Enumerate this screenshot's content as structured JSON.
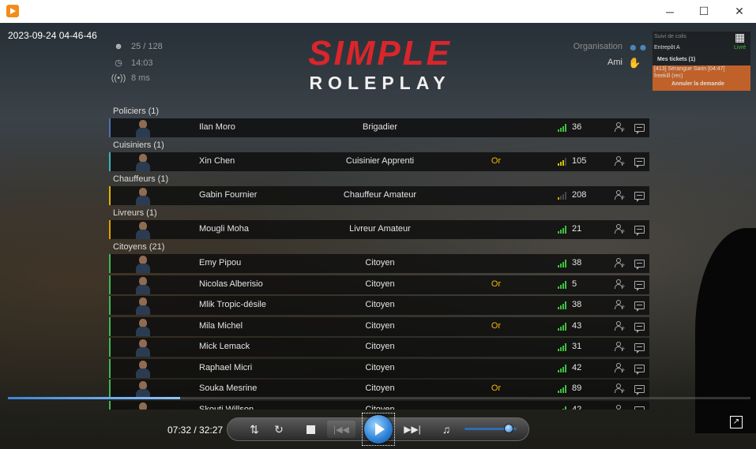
{
  "window": {
    "minimize_glyph": "─",
    "maximize_glyph": "☐",
    "close_glyph": "✕"
  },
  "timestamp": "2023-09-24 04-46-46",
  "stats": {
    "players": "25 / 128",
    "time": "14:03",
    "ping": "8 ms"
  },
  "logo": {
    "top": "SIMPLE",
    "bottom": "ROLEPLAY"
  },
  "relations": {
    "organisation": "Organisation",
    "ami": "Ami"
  },
  "notifications": {
    "suivi": "Suivi de colis",
    "entrepot": "Entrepôt A",
    "livre": "Livré",
    "tickets": "Mes tickets (1)",
    "ticket_line": "[413] Sérangue Sarin [04:47]",
    "ticket_sub": "freekill (rec)",
    "cancel": "Annuler la demande"
  },
  "colors": {
    "police": "#4f6fb5",
    "cook": "#37b7c0",
    "driver": "#e0b400",
    "delivery": "#e0a000",
    "citizen": "#3fb950",
    "signal_good": "#3fbf3f",
    "signal_mid": "#d6c200",
    "signal_low": "#e0a000",
    "vip": "#f5b800"
  },
  "categories": [
    {
      "label": "Policiers (1)",
      "color_key": "police",
      "players": [
        {
          "name": "Ilan Moro",
          "job": "Brigadier",
          "vip": "",
          "ping": "36",
          "signal": 4
        }
      ]
    },
    {
      "label": "Cuisiniers (1)",
      "color_key": "cook",
      "players": [
        {
          "name": "Xin Chen",
          "job": "Cuisinier Apprenti",
          "vip": "Or",
          "ping": "105",
          "signal": 3
        }
      ]
    },
    {
      "label": "Chauffeurs (1)",
      "color_key": "driver",
      "players": [
        {
          "name": "Gabin Fournier",
          "job": "Chauffeur Amateur",
          "vip": "",
          "ping": "208",
          "signal": 1
        }
      ]
    },
    {
      "label": "Livreurs (1)",
      "color_key": "delivery",
      "players": [
        {
          "name": "Mougli Moha",
          "job": "Livreur Amateur",
          "vip": "",
          "ping": "21",
          "signal": 4
        }
      ]
    },
    {
      "label": "Citoyens (21)",
      "color_key": "citizen",
      "players": [
        {
          "name": "Emy Pipou",
          "job": "Citoyen",
          "vip": "",
          "ping": "38",
          "signal": 4
        },
        {
          "name": "Nicolas Alberisio",
          "job": "Citoyen",
          "vip": "Or",
          "ping": "5",
          "signal": 4
        },
        {
          "name": "Mlik Tropic-désile",
          "job": "Citoyen",
          "vip": "",
          "ping": "38",
          "signal": 4
        },
        {
          "name": "Mila Michel",
          "job": "Citoyen",
          "vip": "Or",
          "ping": "43",
          "signal": 4
        },
        {
          "name": "Mick Lemack",
          "job": "Citoyen",
          "vip": "",
          "ping": "31",
          "signal": 4
        },
        {
          "name": "Raphael Micri",
          "job": "Citoyen",
          "vip": "",
          "ping": "42",
          "signal": 4
        },
        {
          "name": "Souka Mesrine",
          "job": "Citoyen",
          "vip": "Or",
          "ping": "89",
          "signal": 4
        },
        {
          "name": "Skouti Willson",
          "job": "Citoyen",
          "vip": "",
          "ping": "42",
          "signal": 4
        }
      ]
    }
  ],
  "player": {
    "timecode": "07:32 / 32:27",
    "progress": 0.232,
    "volume": 0.85,
    "icons": [
      "shuffle-icon",
      "repeat-icon",
      "stop-icon",
      "previous-icon",
      "play-icon",
      "next-icon",
      "volume-icon",
      "fullscreen-icon"
    ]
  }
}
